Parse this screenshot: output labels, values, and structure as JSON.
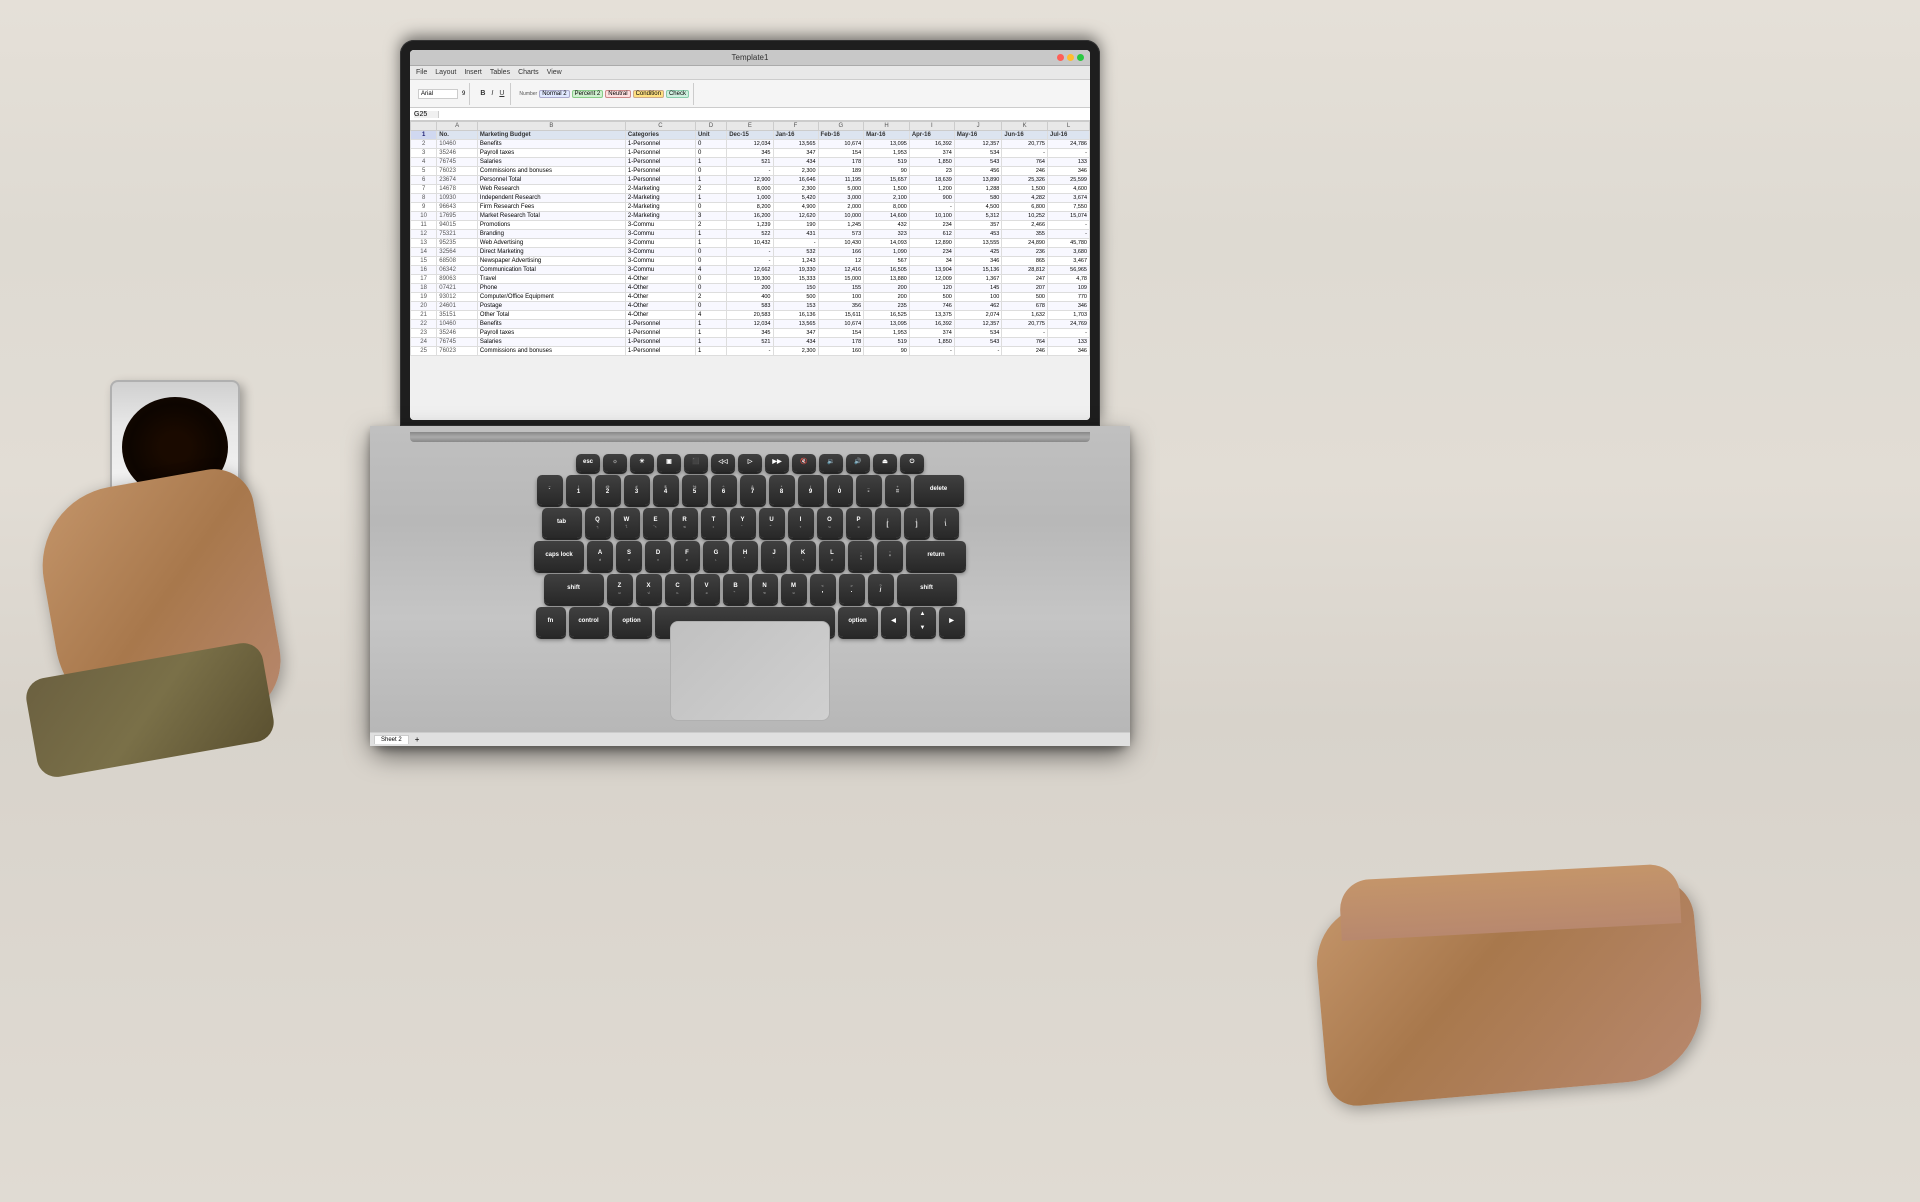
{
  "scene": {
    "title": "Laptop with spreadsheet on wooden table with coffee"
  },
  "window": {
    "title": "Template1",
    "controls": [
      "red",
      "yellow",
      "green"
    ]
  },
  "menu": {
    "items": [
      "File",
      "Layout",
      "Insert",
      "Tables",
      "Charts",
      "View"
    ]
  },
  "toolbar": {
    "font": "Arial",
    "size": "9",
    "cell_ref": "G25"
  },
  "spreadsheet": {
    "headers": [
      "No.",
      "Marketing Budget",
      "Categories",
      "Unit",
      "Dec-15",
      "Jan-16",
      "Feb-16",
      "Mar-16",
      "Apr-16",
      "May-16",
      "Jun-16",
      "Jul-16"
    ],
    "rows": [
      [
        "10460",
        "Benefits",
        "1-Personnel",
        "0",
        "12,034",
        "13,565",
        "10,674",
        "13,095",
        "16,392",
        "12,357",
        "20,775",
        "24,786"
      ],
      [
        "35246",
        "Payroll taxes",
        "1-Personnel",
        "0",
        "345",
        "347",
        "154",
        "1,953",
        "374",
        "534",
        "-",
        "-"
      ],
      [
        "76745",
        "Salaries",
        "1-Personnel",
        "1",
        "521",
        "434",
        "178",
        "519",
        "1,850",
        "543",
        "764",
        "133"
      ],
      [
        "76023",
        "Commissions and bonuses",
        "1-Personnel",
        "0",
        "-",
        "2,300",
        "189",
        "90",
        "23",
        "456",
        "246",
        "346"
      ],
      [
        "23674",
        "Personnel Total",
        "1-Personnel",
        "1",
        "12,900",
        "16,646",
        "11,195",
        "15,657",
        "18,639",
        "13,890",
        "25,326",
        "25,599"
      ],
      [
        "14678",
        "Web Research",
        "2-Marketing",
        "2",
        "8,000",
        "2,300",
        "5,000",
        "1,500",
        "1,200",
        "1,288",
        "1,500",
        "4,600"
      ],
      [
        "10930",
        "Independent Research",
        "2-Marketing",
        "1",
        "1,000",
        "5,420",
        "3,000",
        "2,100",
        "900",
        "580",
        "4,282",
        "3,674"
      ],
      [
        "96643",
        "Firm Research Fees",
        "2-Marketing",
        "0",
        "8,200",
        "4,900",
        "2,000",
        "8,000",
        "-",
        "4,500",
        "6,800",
        "7,550"
      ],
      [
        "17695",
        "Market Research Total",
        "2-Marketing",
        "3",
        "16,200",
        "12,620",
        "10,000",
        "14,600",
        "10,100",
        "5,312",
        "10,252",
        "15,074"
      ],
      [
        "94015",
        "Promotions",
        "3-Commu",
        "2",
        "1,239",
        "190",
        "1,245",
        "432",
        "234",
        "357",
        "2,466",
        "-"
      ],
      [
        "75321",
        "Branding",
        "3-Commu",
        "1",
        "522",
        "431",
        "573",
        "323",
        "612",
        "453",
        "355",
        "-"
      ],
      [
        "95235",
        "Web Advertising",
        "3-Commu",
        "1",
        "10,432",
        "-",
        "10,430",
        "14,093",
        "12,890",
        "13,555",
        "24,890",
        "45,780"
      ],
      [
        "32564",
        "Direct Marketing",
        "3-Commu",
        "0",
        "-",
        "532",
        "166",
        "1,090",
        "234",
        "425",
        "236",
        "3,680"
      ],
      [
        "68508",
        "Newspaper Advertising",
        "3-Commu",
        "0",
        "-",
        "1,243",
        "12",
        "567",
        "34",
        "346",
        "865",
        "3,467"
      ],
      [
        "06342",
        "Communication Total",
        "3-Commu",
        "4",
        "12,662",
        "19,330",
        "12,416",
        "16,505",
        "13,904",
        "15,136",
        "28,812",
        "56,965"
      ],
      [
        "89063",
        "Travel",
        "4-Other",
        "0",
        "19,300",
        "15,333",
        "15,000",
        "13,880",
        "12,009",
        "1,367",
        "247",
        "4,78"
      ],
      [
        "07421",
        "Phone",
        "4-Other",
        "0",
        "200",
        "150",
        "155",
        "200",
        "120",
        "145",
        "207",
        "109"
      ],
      [
        "93012",
        "Computer/Office Equipment",
        "4-Other",
        "2",
        "400",
        "500",
        "100",
        "200",
        "500",
        "100",
        "500",
        "770"
      ],
      [
        "24601",
        "Postage",
        "4-Other",
        "0",
        "583",
        "153",
        "356",
        "235",
        "746",
        "462",
        "678",
        "346"
      ],
      [
        "35151",
        "Other Total",
        "4-Other",
        "4",
        "20,583",
        "16,136",
        "15,611",
        "16,525",
        "13,375",
        "2,074",
        "1,632",
        "1,703"
      ],
      [
        "10460",
        "Benefits",
        "1-Personnel",
        "1",
        "12,034",
        "13,565",
        "10,674",
        "13,095",
        "16,392",
        "12,357",
        "20,775",
        "24,769"
      ],
      [
        "35246",
        "Payroll taxes",
        "1-Personnel",
        "1",
        "345",
        "347",
        "154",
        "1,953",
        "374",
        "534",
        "-",
        "-"
      ],
      [
        "76745",
        "Salaries",
        "1-Personnel",
        "1",
        "521",
        "434",
        "178",
        "519",
        "1,850",
        "543",
        "764",
        "133"
      ],
      [
        "76023",
        "Commissions and bonuses",
        "1-Personnel",
        "1",
        "-",
        "2,300",
        "160",
        "90",
        "-",
        "-",
        "246",
        "346"
      ]
    ],
    "sheet_tabs": [
      "Sheet 2"
    ]
  },
  "keyboard": {
    "caps_lock_label": "caps lock",
    "rows": [
      [
        "esc",
        "F1",
        "F2",
        "F3",
        "F4",
        "F5",
        "F6",
        "F7",
        "F8",
        "F9",
        "F10",
        "F11",
        "F12",
        "power"
      ],
      [
        "~`",
        "1!",
        "2@",
        "3#",
        "4$",
        "5%",
        "6^",
        "7&",
        "8*",
        "9(",
        "0)",
        "_-",
        "+=",
        "delete"
      ],
      [
        "tab",
        "Q",
        "W",
        "E",
        "R",
        "T",
        "Y",
        "U",
        "I",
        "O",
        "P",
        "[{",
        "]}",
        "\\|"
      ],
      [
        "caps lock",
        "A",
        "S",
        "D",
        "F",
        "G",
        "H",
        "J",
        "K",
        "L",
        ";:",
        "'\"",
        "return"
      ],
      [
        "shift",
        "Z",
        "X",
        "C",
        "V",
        "B",
        "N",
        "M",
        ",<",
        ".>",
        "/?",
        "shift"
      ],
      [
        "fn",
        "control",
        "option",
        "",
        "",
        "space",
        "",
        "",
        "",
        "option",
        "◀",
        "▲▼",
        "▶"
      ]
    ]
  },
  "coffee": {
    "label": "Coffee cup"
  }
}
